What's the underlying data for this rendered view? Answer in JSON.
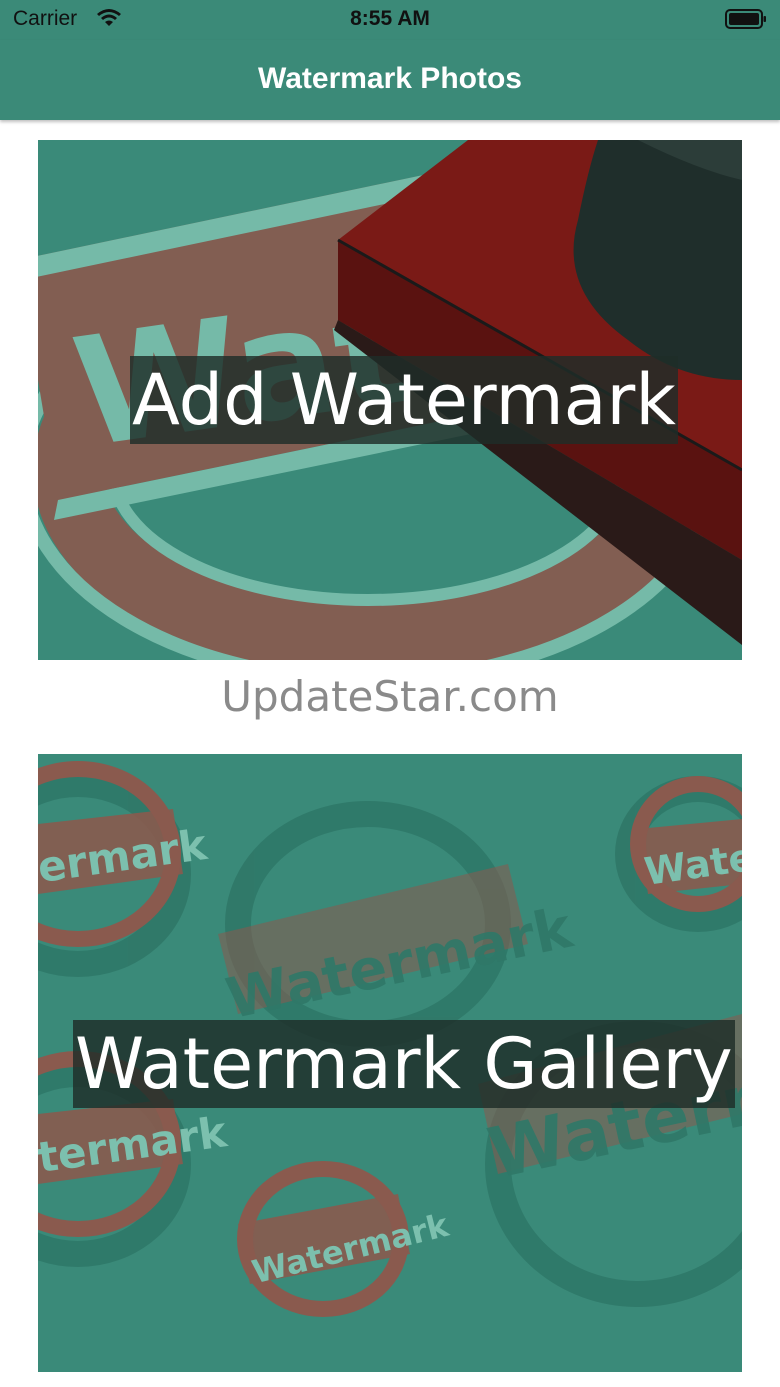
{
  "status": {
    "carrier": "Carrier",
    "time": "8:55 AM",
    "wifi_icon": "wifi-icon",
    "battery_icon": "battery-icon"
  },
  "nav": {
    "title": "Watermark Photos",
    "background": "#3b8a78"
  },
  "cards": [
    {
      "label": "Add Watermark",
      "image": "stamp-press-image"
    },
    {
      "label": "Watermark Gallery",
      "image": "watermark-stamps-pattern-image"
    }
  ],
  "overlay_text": "UpdateStar.com",
  "colors": {
    "teal": "#3a8a79",
    "stamp_brown": "#8a5a4e",
    "stamp_red": "#7a1a16",
    "label_bg": "#1e2d28"
  }
}
